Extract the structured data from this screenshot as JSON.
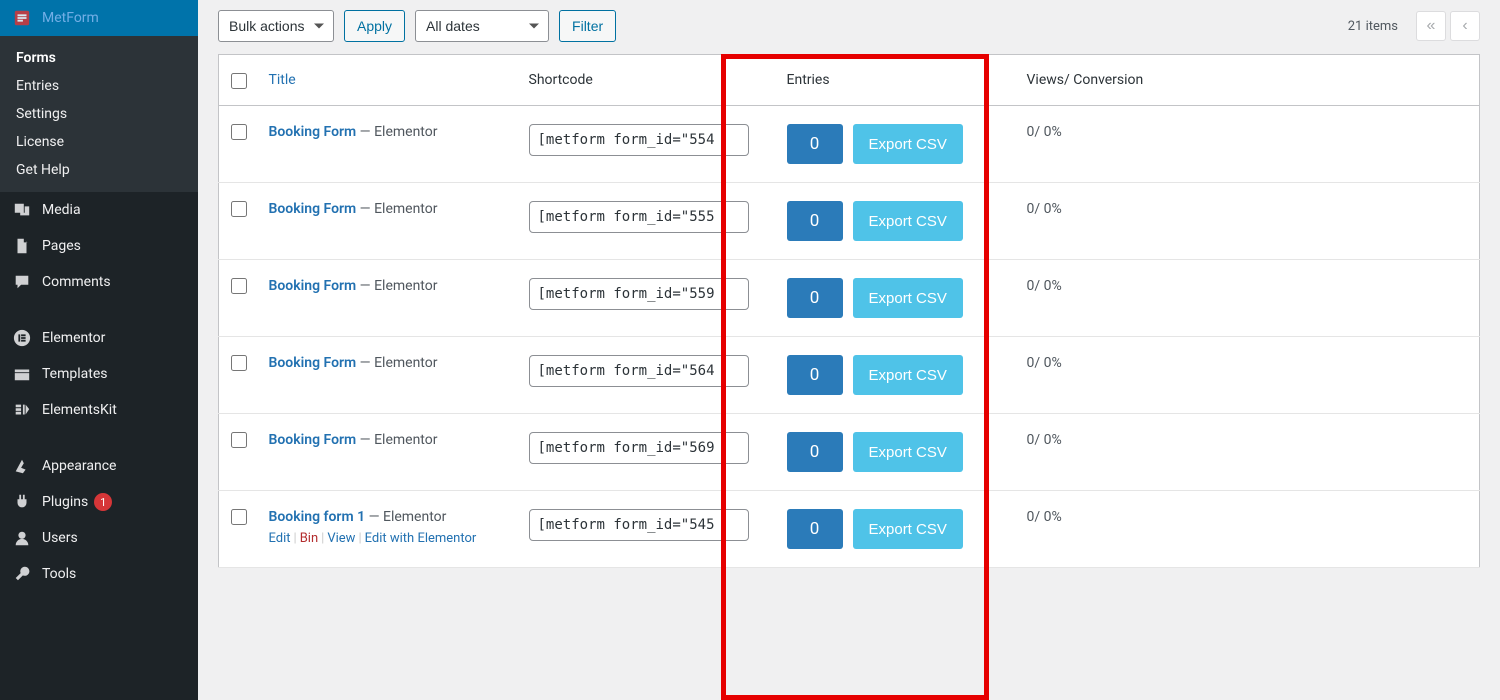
{
  "sidebar": {
    "top": {
      "label": "MetForm"
    },
    "submenu": [
      "Forms",
      "Entries",
      "Settings",
      "License",
      "Get Help"
    ],
    "current_sub": 0,
    "items": [
      {
        "label": "Media",
        "icon": "media"
      },
      {
        "label": "Pages",
        "icon": "pages"
      },
      {
        "label": "Comments",
        "icon": "comments"
      },
      {
        "label": "Elementor",
        "icon": "elementor",
        "sep_before": true
      },
      {
        "label": "Templates",
        "icon": "templates"
      },
      {
        "label": "ElementsKit",
        "icon": "ek"
      },
      {
        "label": "Appearance",
        "icon": "appearance",
        "sep_before": true
      },
      {
        "label": "Plugins",
        "icon": "plugins",
        "badge": "1"
      },
      {
        "label": "Users",
        "icon": "users"
      },
      {
        "label": "Tools",
        "icon": "tools"
      }
    ]
  },
  "toolbar": {
    "bulk": "Bulk actions",
    "apply": "Apply",
    "dates": "All dates",
    "filter": "Filter",
    "count": "21 items"
  },
  "columns": {
    "title": "Title",
    "shortcode": "Shortcode",
    "entries": "Entries",
    "views": "Views/ Conversion"
  },
  "rows": [
    {
      "title": "Booking Form",
      "state": " — Elementor",
      "shortcode": "[metform form_id=\"554",
      "count": "0",
      "export": "Export CSV",
      "views": "0/ 0%"
    },
    {
      "title": "Booking Form",
      "state": " — Elementor",
      "shortcode": "[metform form_id=\"555",
      "count": "0",
      "export": "Export CSV",
      "views": "0/ 0%"
    },
    {
      "title": "Booking Form",
      "state": " — Elementor",
      "shortcode": "[metform form_id=\"559",
      "count": "0",
      "export": "Export CSV",
      "views": "0/ 0%"
    },
    {
      "title": "Booking Form",
      "state": " — Elementor",
      "shortcode": "[metform form_id=\"564",
      "count": "0",
      "export": "Export CSV",
      "views": "0/ 0%"
    },
    {
      "title": "Booking Form",
      "state": " — Elementor",
      "shortcode": "[metform form_id=\"569",
      "count": "0",
      "export": "Export CSV",
      "views": "0/ 0%"
    },
    {
      "title": "Booking form 1",
      "state": " — Elementor",
      "shortcode": "[metform form_id=\"545",
      "count": "0",
      "export": "Export CSV",
      "views": "0/ 0%",
      "actions": true
    }
  ],
  "actions": {
    "edit": "Edit",
    "bin": "Bin",
    "view": "View",
    "ewe": "Edit with Elementor"
  }
}
